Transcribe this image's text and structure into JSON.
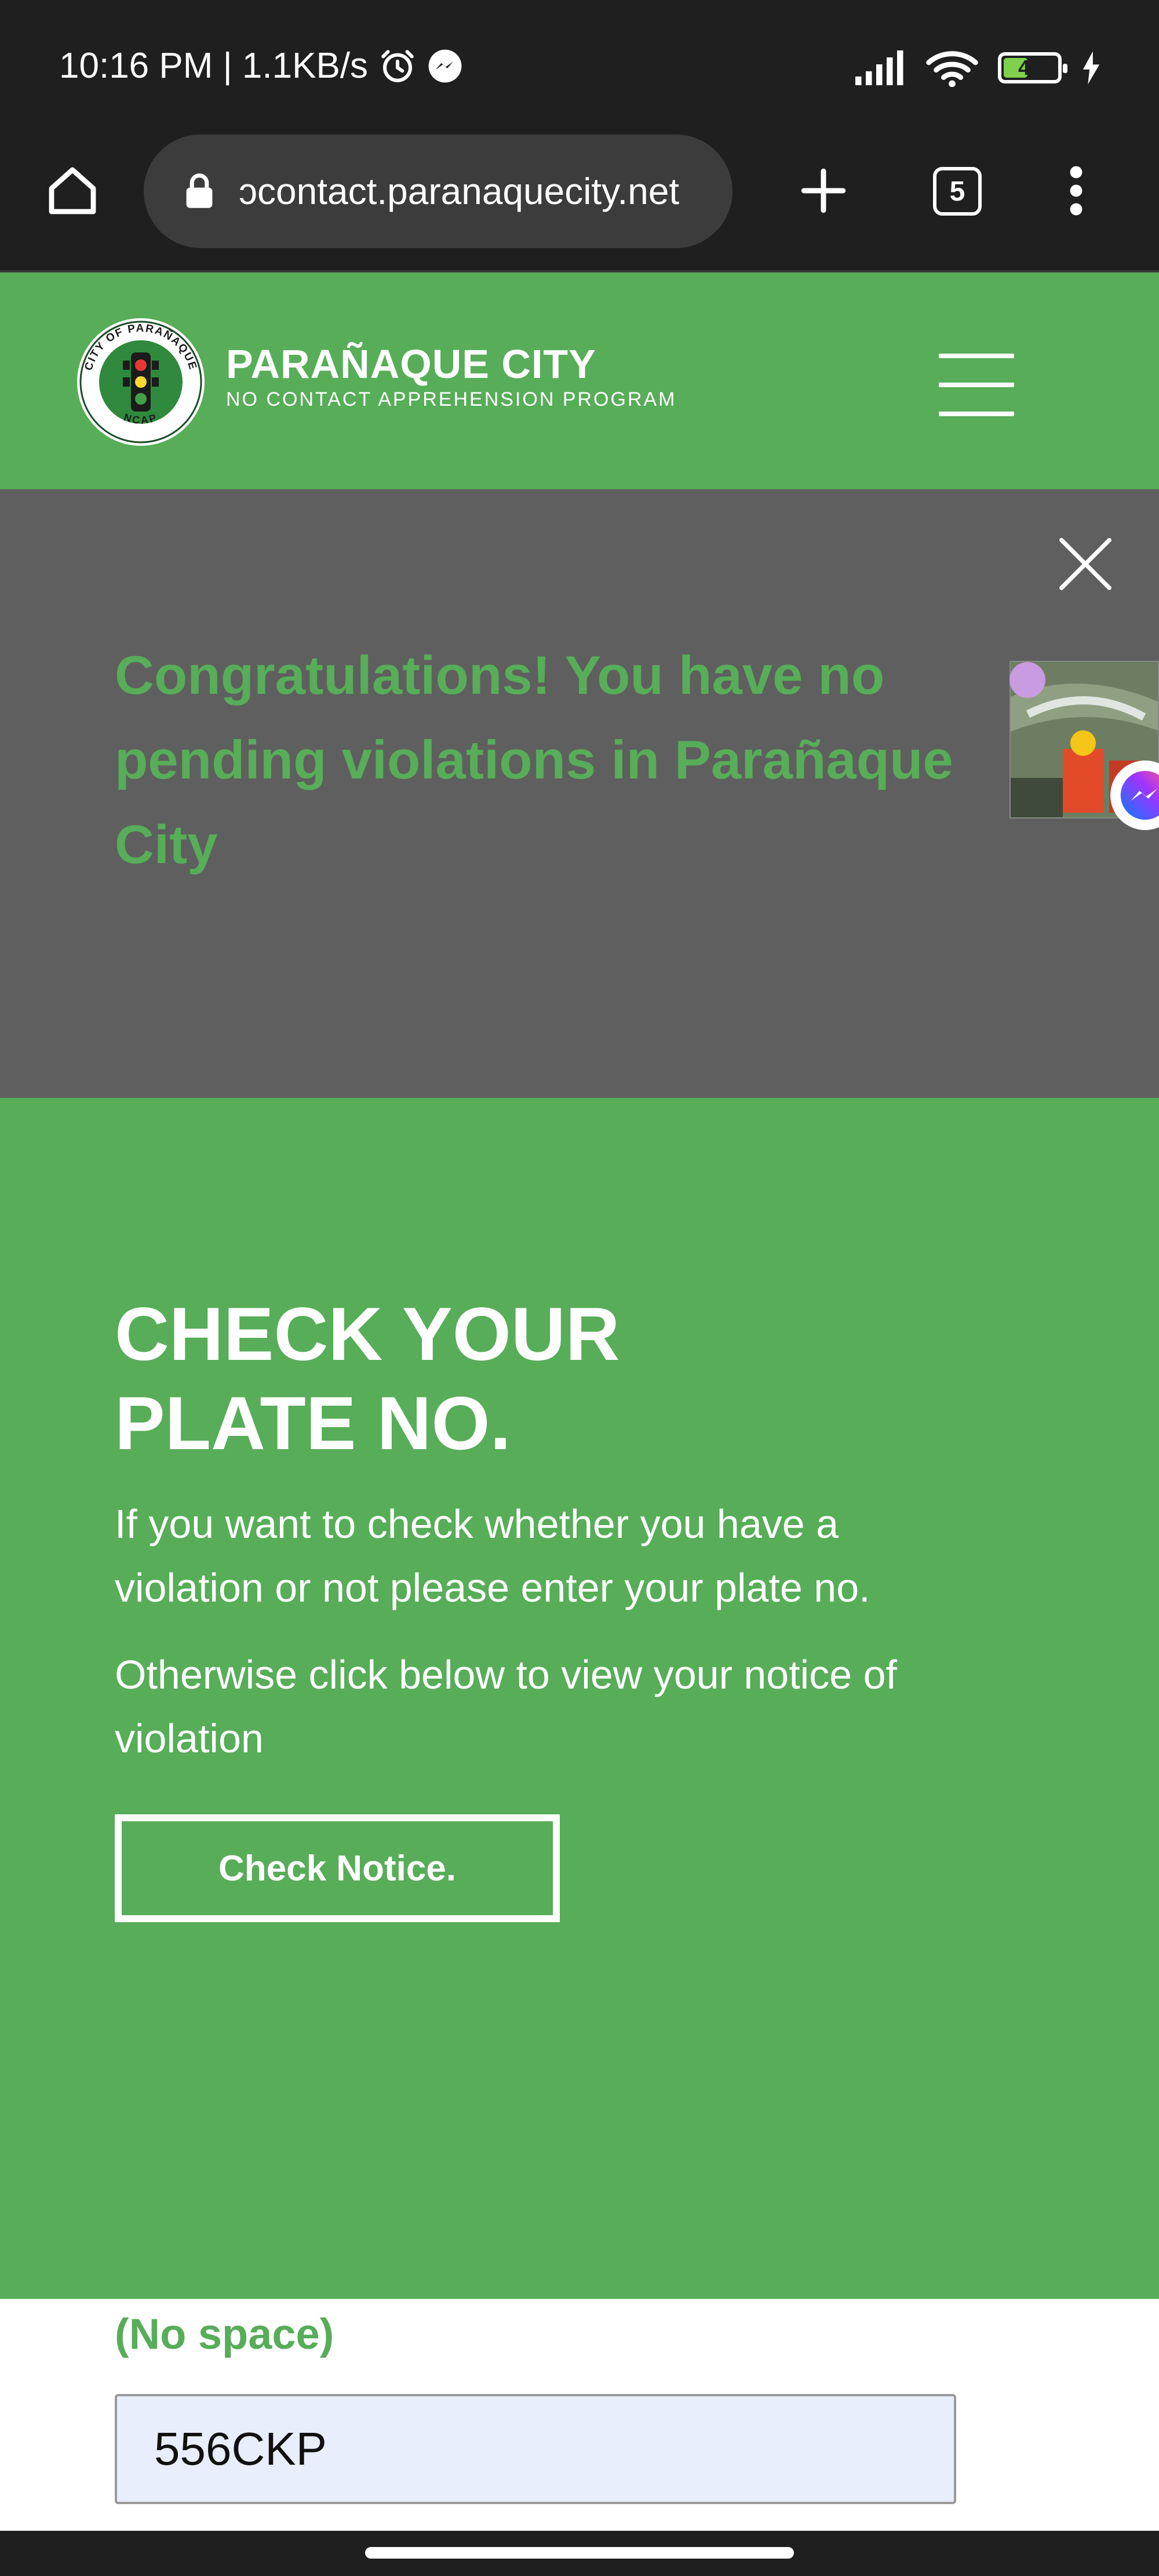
{
  "status_bar": {
    "time_speed": "10:16 PM | 1.1KB/s",
    "battery": "46",
    "battery_level": 0.46,
    "icons": [
      "alarm-icon",
      "messenger-icon",
      "signal-icon",
      "wifi-icon",
      "battery-icon",
      "charging-icon"
    ]
  },
  "browser": {
    "url": "ɔcontact.paranaquecity.net",
    "tab_count": "5",
    "icons": [
      "home-icon",
      "lock-icon",
      "plus-icon",
      "tabs-icon",
      "more-vertical-icon"
    ]
  },
  "header": {
    "title": "PARAÑAQUE CITY",
    "subtitle": "NO CONTACT APPREHENSION PROGRAM",
    "logo_ring_text": "CITY OF PARAÑAQUE",
    "logo_bottom_text": "NCAP",
    "icons": [
      "hamburger-menu-icon"
    ]
  },
  "modal": {
    "message": "Congratulations! You have no pending violations in Parañaque City",
    "icons": [
      "close-icon"
    ]
  },
  "check_section": {
    "heading": "CHECK YOUR PLATE NO.",
    "description": "If you want to check whether you have a violation or not please enter your plate no.",
    "otherwise": "Otherwise click below to view your notice of violation",
    "button_label": "Check Notice."
  },
  "form": {
    "label": "(No space)",
    "plate_value": "556CKP"
  },
  "colors": {
    "brand_green": "#57ad58",
    "modal_gray": "#5f5f5f",
    "chrome_dark": "#1f1f1f",
    "input_bg": "#e8eefb"
  }
}
